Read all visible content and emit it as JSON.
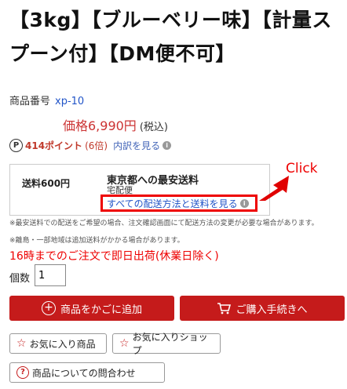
{
  "product": {
    "title": "【3kg】【ブルーベリー味】【計量スプーン付】【DM便不可】",
    "sku_label": "商品番号",
    "sku_code": "xp-10",
    "price": "価格6,990円",
    "tax_note": "(税込)"
  },
  "points": {
    "icon_glyph": "P",
    "value": "414ポイント",
    "multiplier": "(6倍)",
    "breakdown_link": "内訳を見る",
    "info_glyph": "i"
  },
  "shipping": {
    "fee": "送料600円",
    "destination": "東京都への最安送料",
    "method": "宅配便",
    "all_methods_link": "すべての配送方法と送料を見る",
    "info_glyph": "i"
  },
  "annotation": {
    "click_label": "Click",
    "arrow_color": "#e00000"
  },
  "notes": {
    "n1": "※最安送料での配送をご希望の場合、注文確認画面にて配送方法の変更が必要な場合があります。",
    "n2": "※離島・一部地域は追加送料がかかる場合があります。",
    "same_day": "16時までのご注文で即日出荷(休業日除く)"
  },
  "quantity": {
    "label": "個数",
    "value": "1"
  },
  "actions": {
    "add_to_cart": "商品をかごに追加",
    "checkout": "ご購入手続きへ",
    "fav_item": "お気に入り商品",
    "fav_shop": "お気に入りショップ",
    "inquiry": "商品についての問合わせ",
    "plus_glyph": "+",
    "star_glyph": "☆",
    "question_glyph": "?",
    "accent_color": "#c51b1b"
  }
}
